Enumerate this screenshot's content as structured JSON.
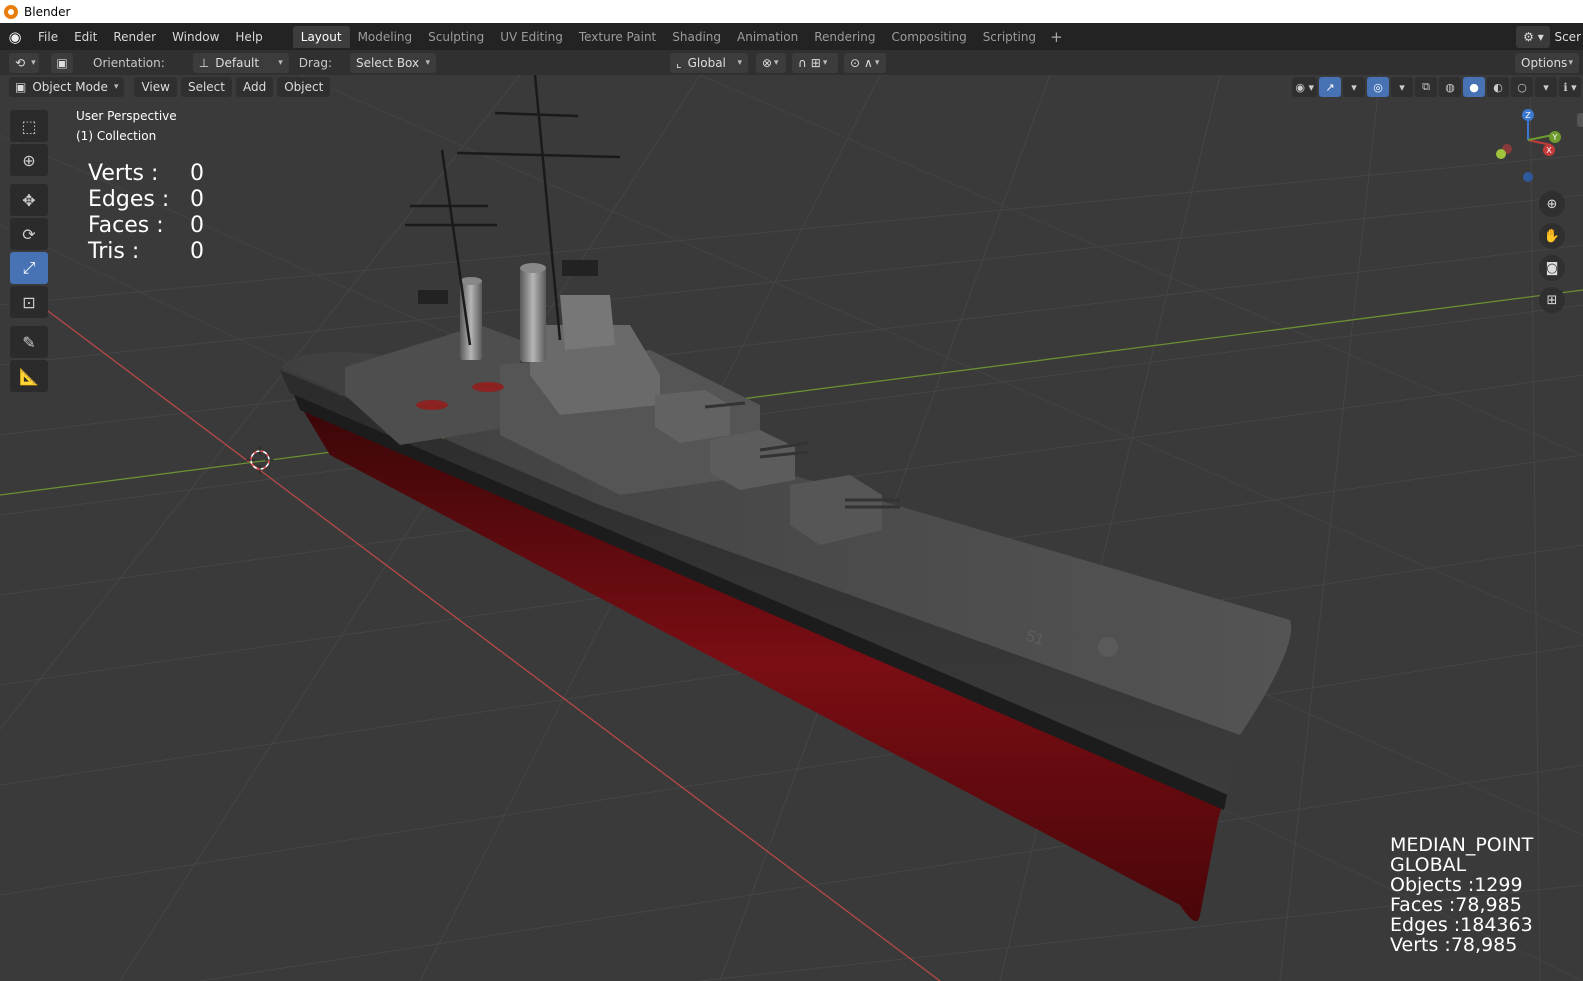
{
  "window": {
    "title": "Blender"
  },
  "menu": {
    "items": [
      "File",
      "Edit",
      "Render",
      "Window",
      "Help"
    ]
  },
  "workspaces": {
    "tabs": [
      "Layout",
      "Modeling",
      "Sculpting",
      "UV Editing",
      "Texture Paint",
      "Shading",
      "Animation",
      "Rendering",
      "Compositing",
      "Scripting"
    ],
    "active": "Layout",
    "add": "+"
  },
  "scene": {
    "name": "Scer"
  },
  "tool_header": {
    "orientation_label": "Orientation:",
    "orientation_value": "Default",
    "drag_label": "Drag:",
    "drag_value": "Select Box",
    "transform_orientation": "Global",
    "options": "Options"
  },
  "viewport_header": {
    "mode": "Object Mode",
    "menus": [
      "View",
      "Select",
      "Add",
      "Object"
    ]
  },
  "overlay_text": {
    "perspective": "User Perspective",
    "collection": "(1) Collection"
  },
  "stats_selected": {
    "rows": [
      {
        "label": "Verts :",
        "value": "0"
      },
      {
        "label": "Edges :",
        "value": "0"
      },
      {
        "label": "Faces :",
        "value": "0"
      },
      {
        "label": "Tris :",
        "value": "0"
      }
    ]
  },
  "stats_scene": {
    "lines": [
      "MEDIAN_POINT",
      "GLOBAL",
      "Objects :1299",
      "Faces :78,985",
      "Edges :184363",
      "Verts :78,985"
    ]
  },
  "model": {
    "hull_number": "51"
  },
  "gizmo": {
    "x": "X",
    "y": "Y",
    "z": "Z"
  },
  "colors": {
    "active_blue": "#4772b3",
    "x_axis": "#c33a3a",
    "y_axis": "#6f9a2e",
    "hull_red": "#6e0e12",
    "ship_gray": "#4a4a4a"
  }
}
